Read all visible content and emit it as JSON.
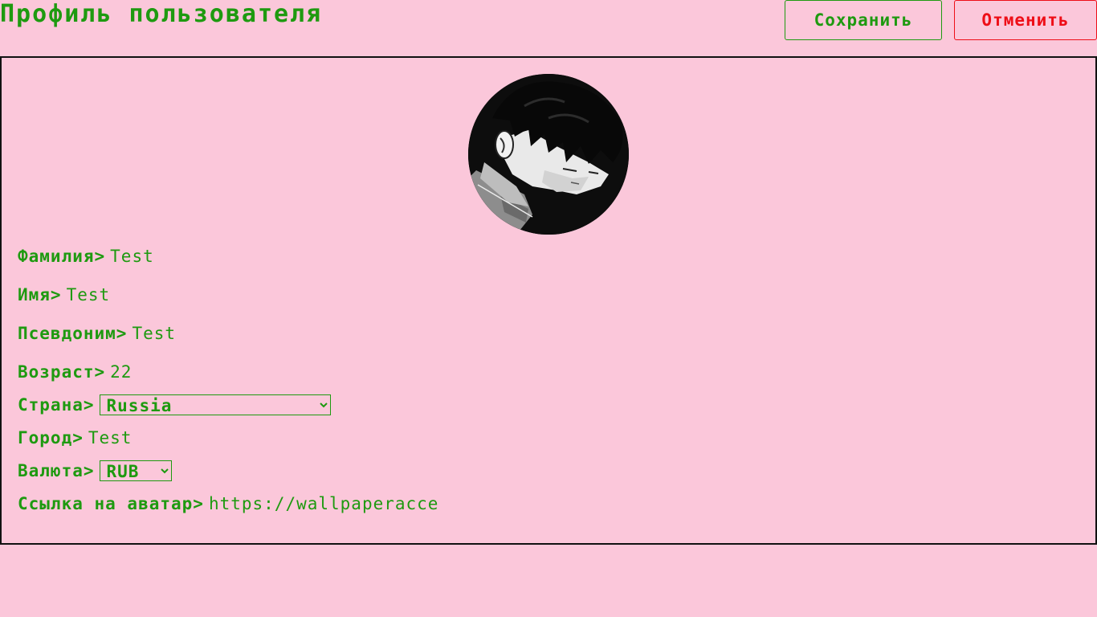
{
  "header": {
    "title": "Профиль пользователя",
    "save_label": "Сохранить",
    "cancel_label": "Отменить"
  },
  "colors": {
    "background": "#fbc7da",
    "text_green": "#1e9a10",
    "cancel_red": "#ee0e17",
    "panel_border": "#111111"
  },
  "profile": {
    "avatar_icon": "avatar-image",
    "fields": {
      "last_name": {
        "label": "Фамилия>",
        "value": "Test"
      },
      "first_name": {
        "label": "Имя>",
        "value": "Test"
      },
      "nickname": {
        "label": "Псевдоним>",
        "value": "Test"
      },
      "age": {
        "label": "Возраст>",
        "value": "22"
      },
      "country": {
        "label": "Страна>",
        "value": "Russia"
      },
      "city": {
        "label": "Город>",
        "value": "Test"
      },
      "currency": {
        "label": "Валюта>",
        "value": "RUB"
      },
      "avatar_link": {
        "label": "Ссылка на аватар>",
        "value": "https://wallpaperacce"
      }
    }
  }
}
